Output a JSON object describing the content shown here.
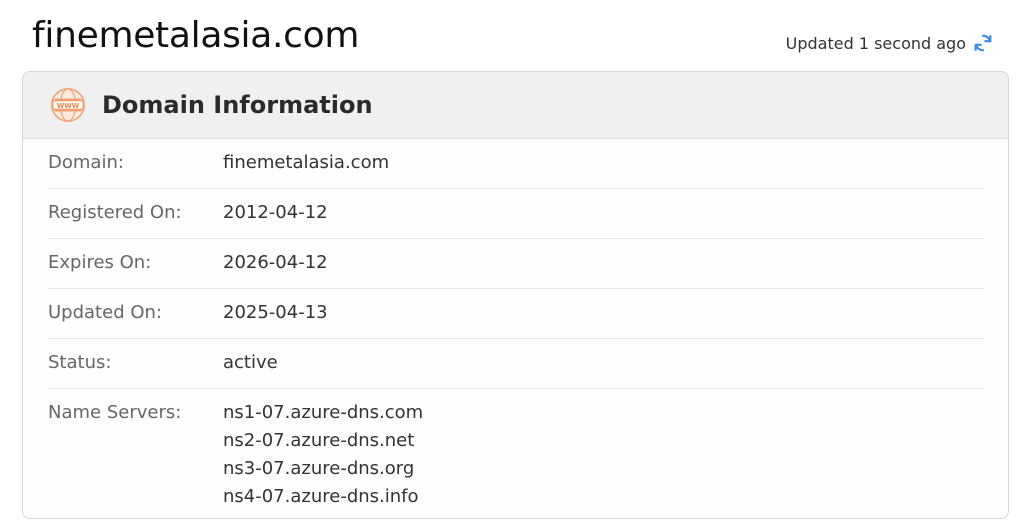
{
  "page": {
    "title": "finemetalasia.com",
    "updated_text": "Updated 1 second ago",
    "refresh_icon": "refresh-icon"
  },
  "card": {
    "title": "Domain Information",
    "icon": "www-icon",
    "rows": [
      {
        "label": "Domain:",
        "value": "finemetalasia.com"
      },
      {
        "label": "Registered On:",
        "value": "2012-04-12"
      },
      {
        "label": "Expires On:",
        "value": "2026-04-12"
      },
      {
        "label": "Updated On:",
        "value": "2025-04-13"
      },
      {
        "label": "Status:",
        "value": "active"
      }
    ],
    "name_servers": {
      "label": "Name Servers:",
      "values": [
        "ns1-07.azure-dns.com",
        "ns2-07.azure-dns.net",
        "ns3-07.azure-dns.org",
        "ns4-07.azure-dns.info"
      ]
    }
  },
  "colors": {
    "accent_orange": "#f0a070",
    "refresh_blue": "#3b8fe0"
  }
}
